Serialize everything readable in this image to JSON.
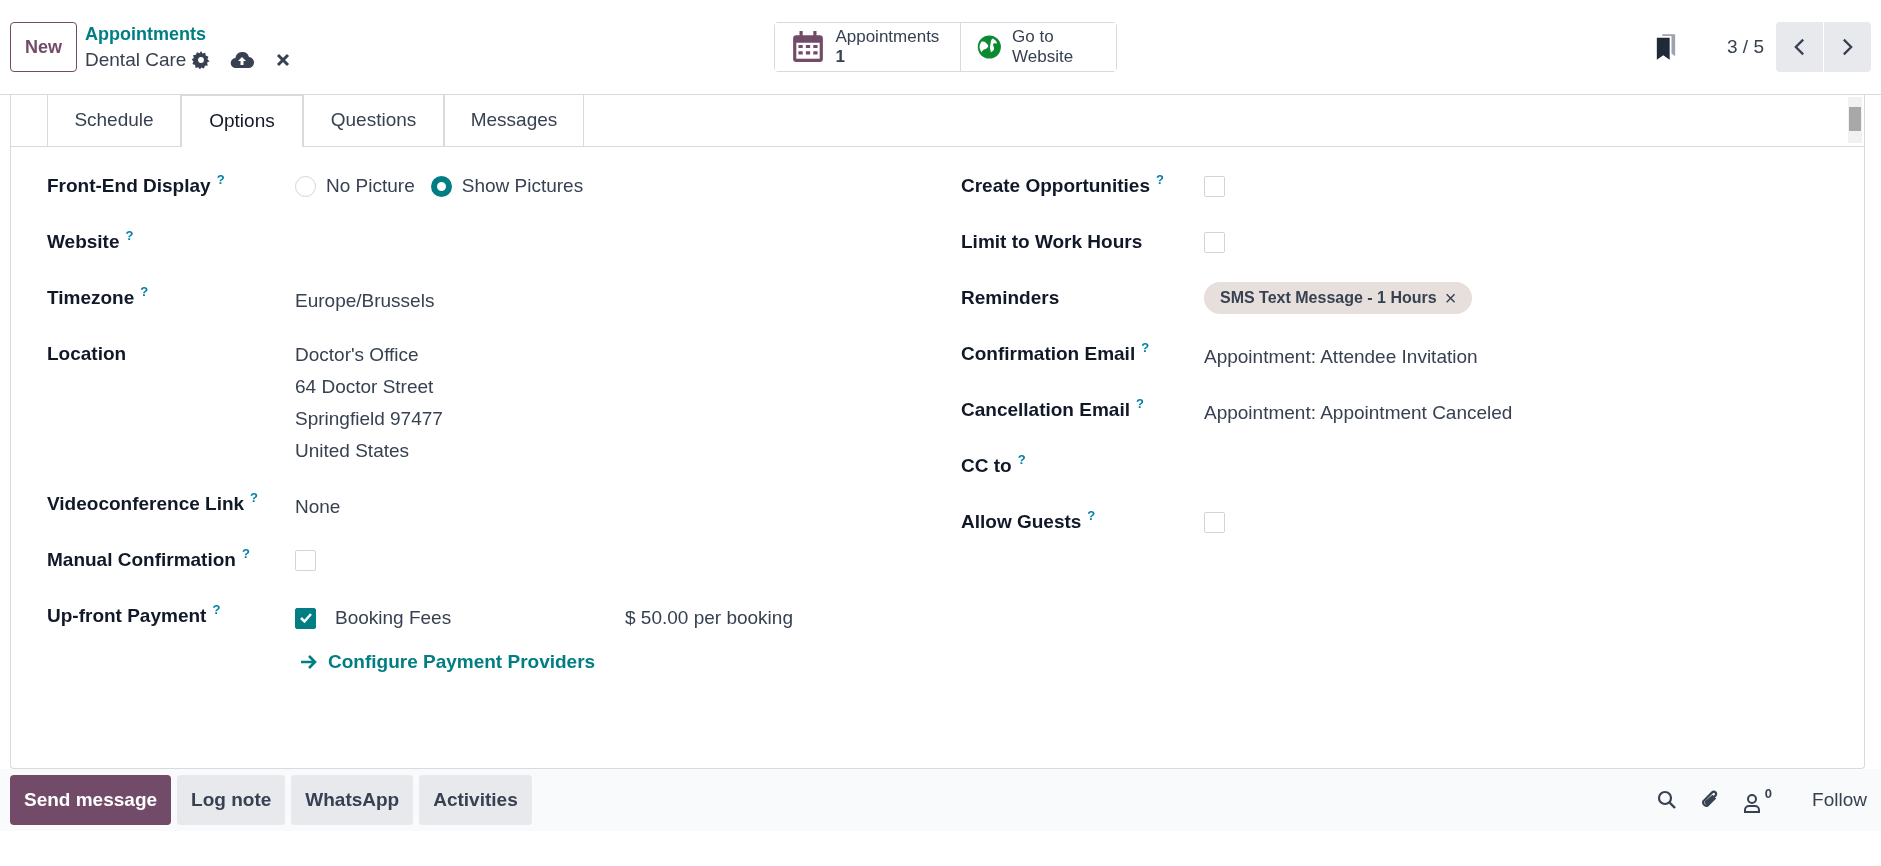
{
  "control_panel": {
    "new_button": "New",
    "breadcrumb": "Appointments",
    "record_name": "Dental Care",
    "smart_buttons": [
      {
        "label": "Appointments",
        "count": "1",
        "kind": "calendar"
      },
      {
        "label": "Go to Website",
        "kind": "globe"
      }
    ],
    "pager": "3 / 5"
  },
  "tabs": [
    {
      "label": "Schedule",
      "selected": false
    },
    {
      "label": "Options",
      "selected": true
    },
    {
      "label": "Questions",
      "selected": false
    },
    {
      "label": "Messages",
      "selected": false
    }
  ],
  "left_fields": [
    {
      "label": "Front-End Display",
      "help": "?",
      "kind": "radio",
      "options": [
        {
          "label": "No Picture",
          "selected": false
        },
        {
          "label": "Show Pictures",
          "selected": true
        }
      ]
    },
    {
      "label": "Website",
      "help": "?",
      "kind": "empty"
    },
    {
      "label": "Timezone",
      "help": "?",
      "kind": "text",
      "value": "Europe/Brussels"
    },
    {
      "label": "Location",
      "kind": "lines",
      "lines": [
        "Doctor's Office",
        "64 Doctor Street",
        "Springfield 97477",
        "United States"
      ]
    },
    {
      "label": "Videoconference Link",
      "help": "?",
      "kind": "text",
      "value": "None"
    },
    {
      "label": "Manual Confirmation",
      "help": "?",
      "kind": "checkbox",
      "checked": false
    },
    {
      "label": "Up-front Payment",
      "help": "?",
      "kind": "payment",
      "checked": true,
      "option": "Booking Fees",
      "amount": "$ 50.00 per booking",
      "link": "Configure Payment Providers"
    }
  ],
  "right_fields": [
    {
      "label": "Create Opportunities",
      "help": "?",
      "kind": "checkbox",
      "checked": false
    },
    {
      "label": "Limit to Work Hours",
      "kind": "checkbox",
      "checked": false
    },
    {
      "label": "Reminders",
      "kind": "tag",
      "tag": "SMS Text Message - 1 Hours",
      "remove": "×"
    },
    {
      "label": "Confirmation Email",
      "help": "?",
      "kind": "text",
      "value": "Appointment: Attendee Invitation"
    },
    {
      "label": "Cancellation Email",
      "help": "?",
      "kind": "text",
      "value": "Appointment: Appointment Canceled"
    },
    {
      "label": "CC to",
      "help": "?",
      "kind": "empty"
    },
    {
      "label": "Allow Guests",
      "help": "?",
      "kind": "checkbox",
      "checked": false
    }
  ],
  "chatter": {
    "buttons": [
      {
        "label": "Send message",
        "selected": true
      },
      {
        "label": "Log note",
        "selected": false
      },
      {
        "label": "WhatsApp",
        "selected": false
      },
      {
        "label": "Activities",
        "selected": false
      }
    ],
    "followers_count": "0",
    "follow": "Follow"
  }
}
